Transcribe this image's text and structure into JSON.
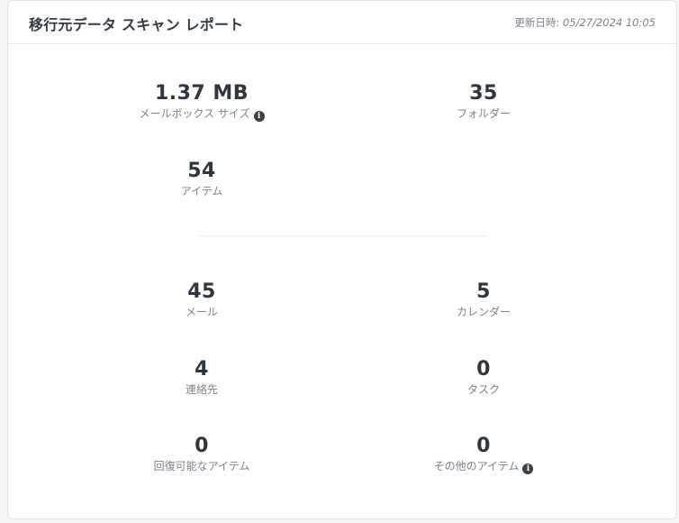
{
  "header": {
    "title": "移行元データ スキャン レポート",
    "updated_label": "更新日時:",
    "updated_value": "05/27/2024 10:05"
  },
  "summary": {
    "mailbox_size": {
      "value": "1.37 MB",
      "label": "メールボックス サイズ"
    },
    "folders": {
      "value": "35",
      "label": "フォルダー"
    },
    "items": {
      "value": "54",
      "label": "アイテム"
    }
  },
  "breakdown": {
    "mail": {
      "value": "45",
      "label": "メール"
    },
    "calendar": {
      "value": "5",
      "label": "カレンダー"
    },
    "contacts": {
      "value": "4",
      "label": "連絡先"
    },
    "tasks": {
      "value": "0",
      "label": "タスク"
    },
    "recoverable": {
      "value": "0",
      "label": "回復可能なアイテム"
    },
    "other": {
      "value": "0",
      "label": "その他のアイテム"
    }
  },
  "icons": {
    "info": "info-icon"
  },
  "info_glyph": "i"
}
